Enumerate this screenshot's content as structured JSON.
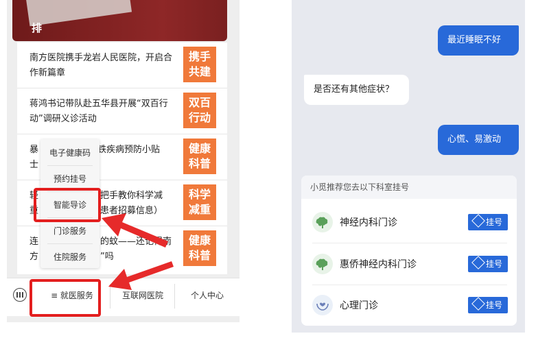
{
  "left": {
    "banner_char": "排",
    "news": [
      {
        "text": "南方医院携手龙岩人民医院，开启合作新篇章",
        "thumb": [
          "携手",
          "共建"
        ]
      },
      {
        "text": "蒋鸿书记带队赴五华县开展“双百行动”调研义诊活动",
        "thumb": [
          "双百",
          "行动"
        ]
      },
      {
        "text": "暴",
        "text2": "铁疾病预防小贴",
        "text3": "士",
        "thumb": [
          "健康",
          "科普"
        ]
      },
      {
        "text": "轻",
        "text2": "把手教你科学减",
        "text3": "重",
        "text4": "患者招募信息）",
        "thumb": [
          "科学",
          "减重"
        ]
      },
      {
        "text": "连",
        "text2": "的蚊——还记得南",
        "text3": "方",
        "text4": "”吗",
        "thumb": [
          "健康",
          "科普"
        ]
      }
    ],
    "popup_items": [
      "电子健康码",
      "预约挂号",
      "智能导诊",
      "门诊服务",
      "住院服务"
    ],
    "tabbar": {
      "keyboard_icon": "keyboard-icon",
      "tabs": [
        "≡ 就医服务",
        "互联网医院",
        "个人中心"
      ]
    },
    "highlight_color": "#e31e1e"
  },
  "right": {
    "messages": [
      {
        "from": "user",
        "text": "最近睡眠不好"
      },
      {
        "from": "bot",
        "text": "是否还有其他症状？"
      },
      {
        "from": "user",
        "text": "心慌、易激动"
      }
    ],
    "recommend": {
      "title": "小觅推荐您去以下科室挂号",
      "departments": [
        {
          "name": "神经内科门诊",
          "icon": "brain-icon",
          "button": "挂号"
        },
        {
          "name": "惠侨神经内科门诊",
          "icon": "brain-icon",
          "button": "挂号"
        },
        {
          "name": "心理门诊",
          "icon": "hands-heart-icon",
          "button": "挂号"
        }
      ]
    },
    "accent_color": "#2869d9"
  }
}
